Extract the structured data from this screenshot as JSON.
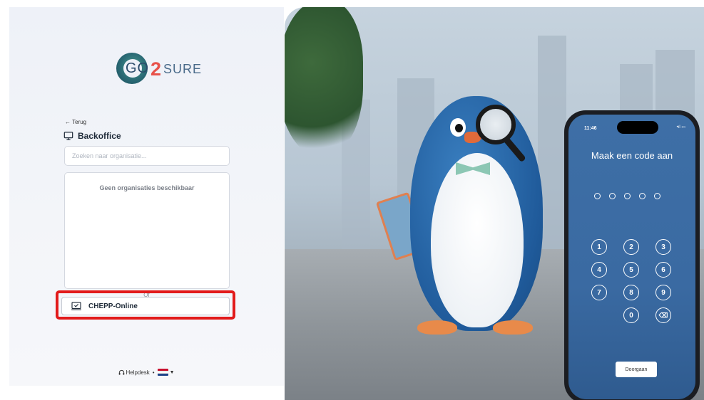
{
  "logo": {
    "go": "GO",
    "two": "2",
    "sure": "SURE"
  },
  "back_link": "← Terug",
  "section_title": "Backoffice",
  "search": {
    "placeholder": "Zoeken naar organisatie...",
    "value": ""
  },
  "org_list": {
    "empty_text": "Geen organisaties beschikbaar"
  },
  "or_text": "Of",
  "chepp_button": "CHEPP-Online",
  "footer": {
    "helpdesk": "Helpdesk",
    "separator": "•"
  },
  "phone": {
    "time": "11:46",
    "status": "•ıl ▭",
    "title": "Maak een code aan",
    "keys": [
      "1",
      "2",
      "3",
      "4",
      "5",
      "6",
      "7",
      "8",
      "9",
      "0"
    ],
    "backspace": "⌫",
    "continue_button": "Doorgaan"
  },
  "colors": {
    "highlight": "#e21b1b",
    "phone_screen": "#3a6aa2",
    "logo_red": "#e8524a"
  }
}
